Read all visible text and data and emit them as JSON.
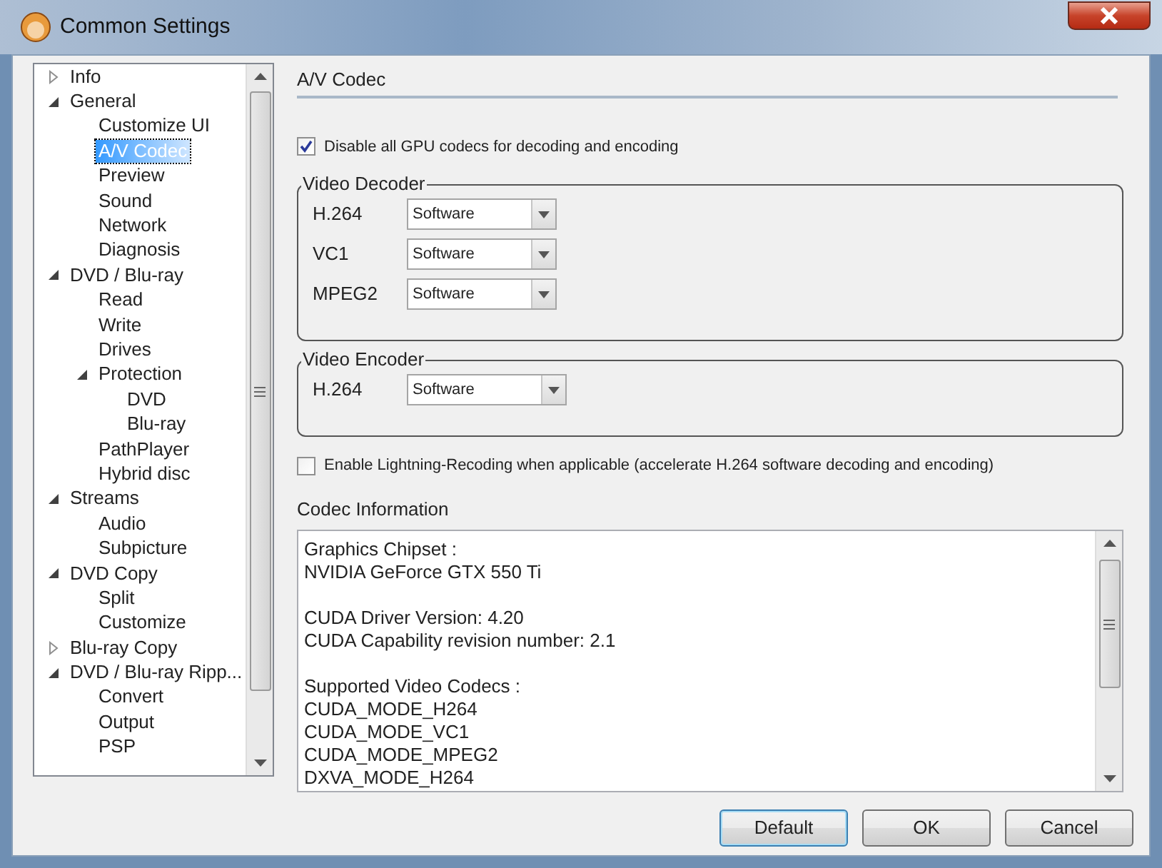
{
  "window": {
    "title": "Common Settings"
  },
  "tree": [
    {
      "label": "Info",
      "expanded": false,
      "selected": false
    },
    {
      "label": "General",
      "expanded": true,
      "selected": false,
      "children": [
        {
          "label": "Customize UI",
          "selected": false
        },
        {
          "label": "A/V Codec",
          "selected": true
        },
        {
          "label": "Preview",
          "selected": false
        },
        {
          "label": "Sound",
          "selected": false
        },
        {
          "label": "Network",
          "selected": false
        },
        {
          "label": "Diagnosis",
          "selected": false
        }
      ]
    },
    {
      "label": "DVD / Blu-ray",
      "expanded": true,
      "selected": false,
      "children": [
        {
          "label": "Read",
          "selected": false
        },
        {
          "label": "Write",
          "selected": false
        },
        {
          "label": "Drives",
          "selected": false
        },
        {
          "label": "Protection",
          "expanded": true,
          "selected": false,
          "children": [
            {
              "label": "DVD",
              "selected": false
            },
            {
              "label": "Blu-ray",
              "selected": false
            }
          ]
        },
        {
          "label": "PathPlayer",
          "selected": false
        },
        {
          "label": "Hybrid disc",
          "selected": false
        }
      ]
    },
    {
      "label": "Streams",
      "expanded": true,
      "selected": false,
      "children": [
        {
          "label": "Audio",
          "selected": false
        },
        {
          "label": "Subpicture",
          "selected": false
        }
      ]
    },
    {
      "label": "DVD Copy",
      "expanded": true,
      "selected": false,
      "children": [
        {
          "label": "Split",
          "selected": false
        },
        {
          "label": "Customize",
          "selected": false
        }
      ]
    },
    {
      "label": "Blu-ray Copy",
      "expanded": false,
      "selected": false
    },
    {
      "label": "DVD / Blu-ray Ripp...",
      "expanded": true,
      "selected": false,
      "children": [
        {
          "label": "Convert",
          "selected": false
        },
        {
          "label": "Output",
          "selected": false
        },
        {
          "label": "PSP",
          "selected": false
        }
      ]
    }
  ],
  "panel": {
    "heading": "A/V Codec",
    "disable_gpu": {
      "label": "Disable all GPU codecs for decoding and encoding",
      "checked": true
    },
    "groups": [
      {
        "title": "Video Decoder",
        "rows": [
          {
            "label": "H.264",
            "value": "Software"
          },
          {
            "label": "VC1",
            "value": "Software"
          },
          {
            "label": "MPEG2",
            "value": "Software"
          }
        ]
      },
      {
        "title": "Video Encoder",
        "rows": [
          {
            "label": "H.264",
            "value": "Software"
          }
        ]
      }
    ],
    "lightning": {
      "label": "Enable Lightning-Recoding when applicable (accelerate H.264 software decoding and encoding)",
      "checked": false
    },
    "info_title": "Codec Information",
    "info_blocks": [
      [
        "Graphics Chipset :",
        "NVIDIA GeForce GTX 550 Ti"
      ],
      [
        "CUDA Driver Version: 4.20",
        "CUDA Capability revision number: 2.1"
      ],
      [
        "Supported Video Codecs :",
        "CUDA_MODE_H264",
        "CUDA_MODE_VC1",
        "CUDA_MODE_MPEG2",
        "DXVA_MODE_H264"
      ]
    ]
  },
  "buttons": [
    "Default",
    "OK",
    "Cancel"
  ]
}
